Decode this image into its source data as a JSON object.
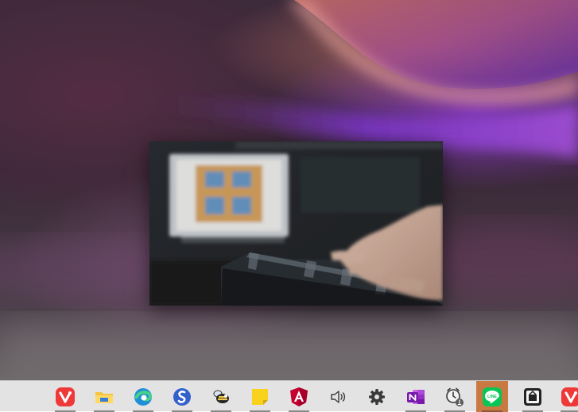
{
  "desktop": {
    "wallpaper": "abstract-purple-wave"
  },
  "video_preview": {
    "content": "hands-on-keyboard-video"
  },
  "taskbar": {
    "colors": {
      "background": "#e3e3e3",
      "active_highlight": "#c97a43"
    },
    "items": [
      {
        "name": "vivaldi",
        "icon": "vivaldi-icon",
        "color": "#ef3939",
        "active": false
      },
      {
        "name": "file-explorer",
        "icon": "folder-icon",
        "color": "#f6c33c",
        "active": false
      },
      {
        "name": "microsoft-edge",
        "icon": "edge-icon",
        "color": "#1f8fd8",
        "active": false
      },
      {
        "name": "simplenote",
        "icon": "simplenote-icon",
        "color": "#3361cc",
        "active": false
      },
      {
        "name": "bee-app",
        "icon": "bee-icon",
        "color": "#f2c94c",
        "active": false
      },
      {
        "name": "sticky-notes",
        "icon": "sticky-note-icon",
        "color": "#f8d21c",
        "active": false
      },
      {
        "name": "angular",
        "icon": "angular-icon",
        "color": "#c3002f",
        "active": false
      },
      {
        "name": "volume",
        "icon": "speaker-icon",
        "color": "#3a3a3a",
        "active": false
      },
      {
        "name": "settings",
        "icon": "gear-icon",
        "color": "#3a3a3a",
        "active": false
      },
      {
        "name": "onenote",
        "icon": "onenote-icon",
        "color": "#7719aa",
        "active": false
      },
      {
        "name": "alarms-clock",
        "icon": "alarm-clock-icon",
        "color": "#3a3a3a",
        "active": false
      },
      {
        "name": "line",
        "icon": "line-icon",
        "color": "#06c755",
        "active": true
      },
      {
        "name": "media-app",
        "icon": "media-icon",
        "color": "#222222",
        "active": false
      },
      {
        "name": "vivaldi-2",
        "icon": "vivaldi-icon",
        "color": "#ef3939",
        "active": false
      }
    ]
  }
}
